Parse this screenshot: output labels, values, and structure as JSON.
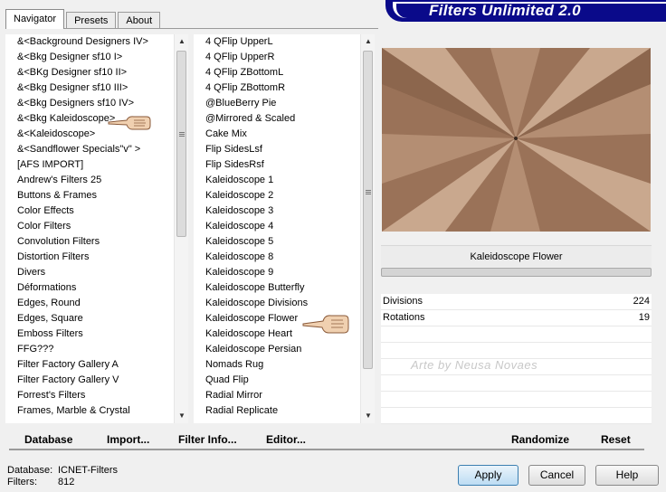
{
  "tabs": [
    {
      "label": "Navigator",
      "active": true
    },
    {
      "label": "Presets",
      "active": false
    },
    {
      "label": "About",
      "active": false
    }
  ],
  "banner": {
    "title": "Filters Unlimited 2.0"
  },
  "categories": [
    "&<Background Designers IV>",
    "&<Bkg Designer sf10 I>",
    "&<BKg Designer sf10 II>",
    "&<Bkg Designer sf10 III>",
    "&<Bkg Designers sf10 IV>",
    "&<Bkg Kaleidoscope>",
    "&<Kaleidoscope>",
    "&<Sandflower Specials\"v\" >",
    "[AFS IMPORT]",
    "Andrew's Filters 25",
    "Buttons & Frames",
    "Color Effects",
    "Color Filters",
    "Convolution Filters",
    "Distortion Filters",
    "Divers",
    "Déformations",
    "Edges, Round",
    "Edges, Square",
    "Emboss Filters",
    "FFG???",
    "Filter Factory Gallery A",
    "Filter Factory Gallery V",
    "Forrest's Filters",
    "Frames, Marble & Crystal"
  ],
  "filters": [
    "4 QFlip UpperL",
    "4 QFlip UpperR",
    "4 QFlip ZBottomL",
    "4 QFlip ZBottomR",
    "@BlueBerry Pie",
    "@Mirrored & Scaled",
    "Cake Mix",
    "Flip SidesLsf",
    "Flip SidesRsf",
    "Kaleidoscope 1",
    "Kaleidoscope 2",
    "Kaleidoscope 3",
    "Kaleidoscope 4",
    "Kaleidoscope 5",
    "Kaleidoscope 8",
    "Kaleidoscope 9",
    "Kaleidoscope Butterfly",
    "Kaleidoscope Divisions",
    "Kaleidoscope Flower",
    "Kaleidoscope Heart",
    "Kaleidoscope Persian",
    "Nomads Rug",
    "Quad Flip",
    "Radial Mirror",
    "Radial Replicate"
  ],
  "selected_filter": "Kaleidoscope Flower",
  "settings": [
    {
      "label": "Divisions",
      "value": "224"
    },
    {
      "label": "Rotations",
      "value": "19"
    }
  ],
  "watermark": "Arte by Neusa Novaes",
  "toolbar": {
    "database": "Database",
    "import": "Import...",
    "filter_info": "Filter Info...",
    "editor": "Editor...",
    "randomize": "Randomize",
    "reset": "Reset"
  },
  "status": {
    "database_label": "Database:",
    "database_value": "ICNET-Filters",
    "filters_label": "Filters:",
    "filters_value": "812"
  },
  "buttons": {
    "apply": "Apply",
    "cancel": "Cancel",
    "help": "Help"
  },
  "colors": {
    "banner": "#0a0a8a",
    "preview_base": "#9a7258",
    "default_button": "#bcdcf3"
  }
}
